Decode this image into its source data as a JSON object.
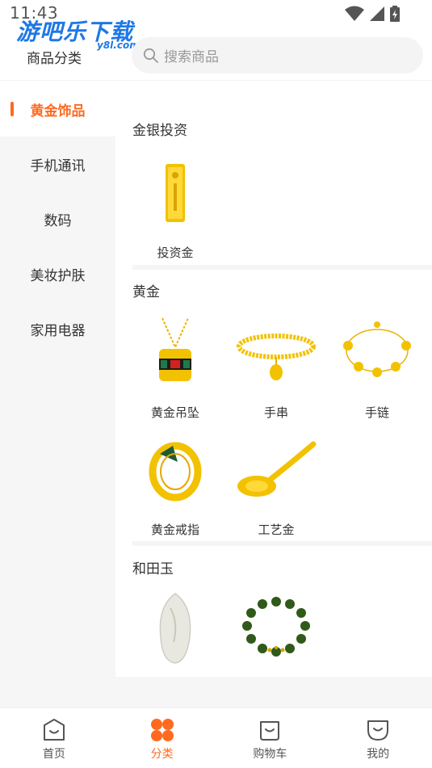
{
  "status": {
    "time": "11:43"
  },
  "watermark": {
    "main": "游吧乐下载",
    "sub": "y8l.com"
  },
  "header": {
    "title": "商品分类",
    "search_placeholder": "搜索商品"
  },
  "sidebar": {
    "items": [
      {
        "label": "黄金饰品"
      },
      {
        "label": "手机通讯"
      },
      {
        "label": "数码"
      },
      {
        "label": "美妆护肤"
      },
      {
        "label": "家用电器"
      }
    ]
  },
  "sections": [
    {
      "title": "金银投资",
      "products": [
        {
          "name": "投资金",
          "icon": "gold-bar-image"
        }
      ]
    },
    {
      "title": "黄金",
      "products": [
        {
          "name": "黄金吊坠",
          "icon": "pendant-image"
        },
        {
          "name": "手串",
          "icon": "bead-bracelet-image"
        },
        {
          "name": "手链",
          "icon": "chain-bracelet-image"
        },
        {
          "name": "黄金戒指",
          "icon": "ring-image"
        },
        {
          "name": "工艺金",
          "icon": "gold-spoon-image"
        }
      ]
    },
    {
      "title": "和田玉",
      "products": [
        {
          "name": "",
          "icon": "jade-pendant-image"
        },
        {
          "name": "",
          "icon": "jade-bracelet-image"
        }
      ]
    }
  ],
  "tabbar": {
    "tabs": [
      {
        "label": "首页",
        "icon": "home-icon"
      },
      {
        "label": "分类",
        "icon": "category-icon"
      },
      {
        "label": "购物车",
        "icon": "cart-icon"
      },
      {
        "label": "我的",
        "icon": "profile-icon"
      }
    ]
  },
  "colors": {
    "accent": "#ff6a1f",
    "sidebar_bg": "#f6f6f6",
    "gold": "#f5c400"
  }
}
